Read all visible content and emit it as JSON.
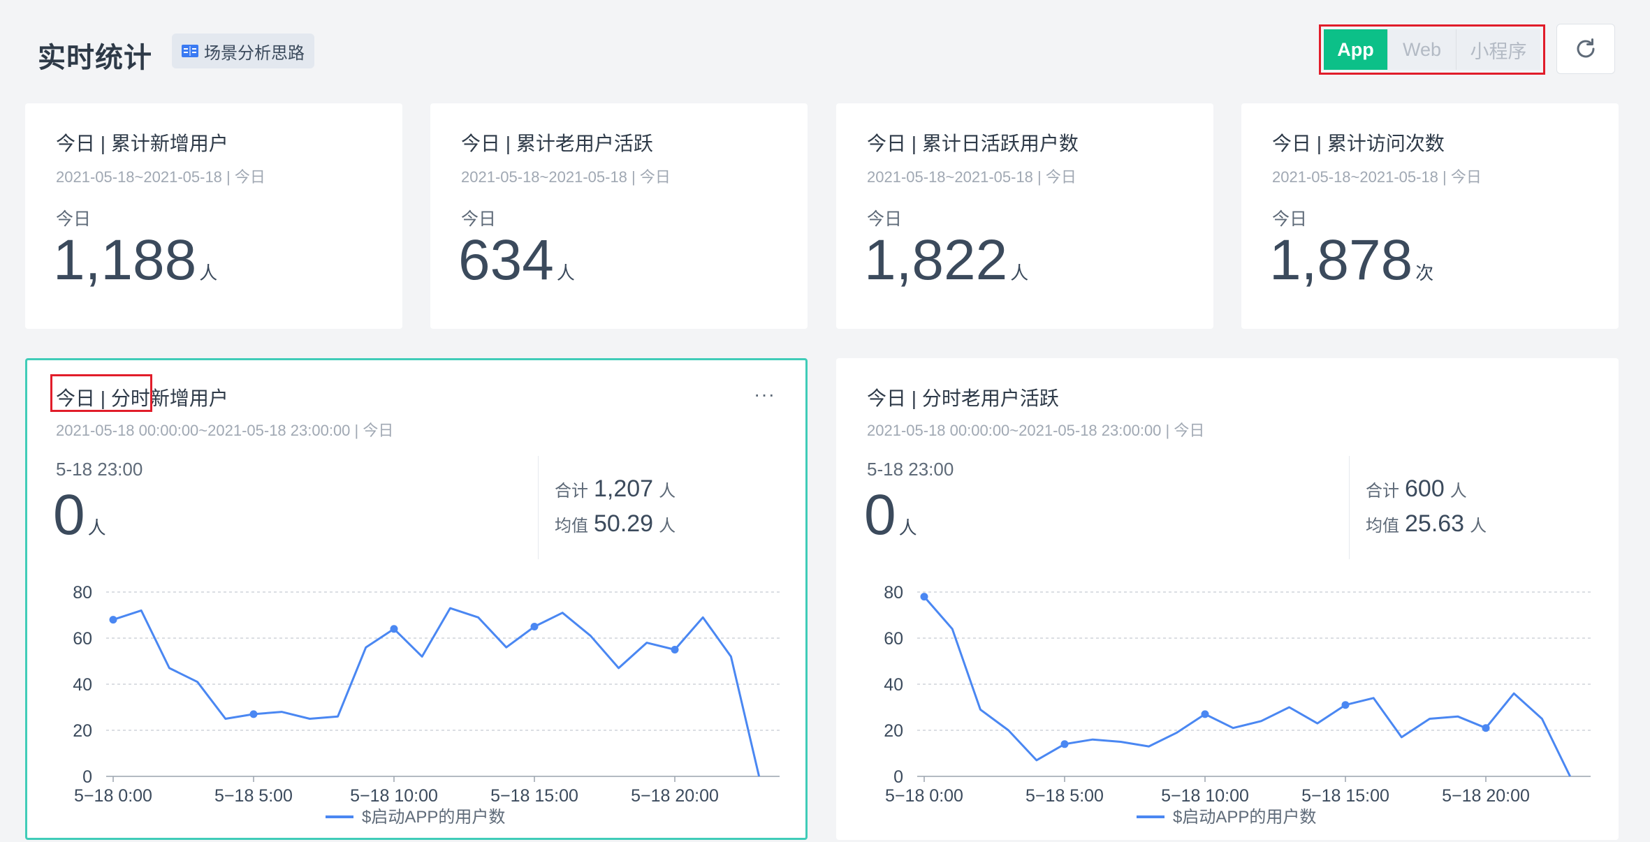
{
  "header": {
    "title": "实时统计",
    "scene_tag": "场景分析思路",
    "platforms": [
      "App",
      "Web",
      "小程序"
    ],
    "active_platform": "App"
  },
  "kpis": [
    {
      "title": "今日 | 累计新增用户",
      "date": "2021-05-18~2021-05-18 | 今日",
      "period": "今日",
      "value": "1,188",
      "unit": "人"
    },
    {
      "title": "今日 | 累计老用户活跃",
      "date": "2021-05-18~2021-05-18 | 今日",
      "period": "今日",
      "value": "634",
      "unit": "人"
    },
    {
      "title": "今日 | 累计日活跃用户数",
      "date": "2021-05-18~2021-05-18 | 今日",
      "period": "今日",
      "value": "1,822",
      "unit": "人"
    },
    {
      "title": "今日 | 累计访问次数",
      "date": "2021-05-18~2021-05-18 | 今日",
      "period": "今日",
      "value": "1,878",
      "unit": "次"
    }
  ],
  "charts": [
    {
      "title": "今日 | 分时新增用户",
      "date": "2021-05-18 00:00:00~2021-05-18 23:00:00 | 今日",
      "time": "5-18 23:00",
      "current": "0",
      "unit": "人",
      "sum_label": "合计",
      "sum": "1,207",
      "sum_unit": "人",
      "avg_label": "均值",
      "avg": "50.29",
      "avg_unit": "人",
      "more": "···"
    },
    {
      "title": "今日 | 分时老用户活跃",
      "date": "2021-05-18 00:00:00~2021-05-18 23:00:00 | 今日",
      "time": "5-18 23:00",
      "current": "0",
      "unit": "人",
      "sum_label": "合计",
      "sum": "600",
      "sum_unit": "人",
      "avg_label": "均值",
      "avg": "25.63",
      "avg_unit": "人"
    }
  ],
  "chart_data": [
    {
      "type": "line",
      "x": [
        "0:00",
        "1:00",
        "2:00",
        "3:00",
        "4:00",
        "5:00",
        "6:00",
        "7:00",
        "8:00",
        "9:00",
        "10:00",
        "11:00",
        "12:00",
        "13:00",
        "14:00",
        "15:00",
        "16:00",
        "17:00",
        "18:00",
        "19:00",
        "20:00",
        "21:00",
        "22:00",
        "23:00"
      ],
      "xticks": [
        "5−18 0:00",
        "5−18 5:00",
        "5−18 10:00",
        "5−18 15:00",
        "5−18 20:00"
      ],
      "yticks": [
        0,
        20,
        40,
        60,
        80
      ],
      "ylim": [
        0,
        80
      ],
      "series": [
        {
          "name": "$启动APP的用户数",
          "values": [
            68,
            72,
            47,
            41,
            25,
            27,
            28,
            25,
            26,
            56,
            64,
            52,
            73,
            69,
            56,
            65,
            71,
            61,
            47,
            58,
            55,
            69,
            52,
            0
          ]
        }
      ],
      "markers": [
        0,
        5,
        10,
        15,
        20
      ],
      "color": "#4a87f2",
      "grid": true,
      "legend": "bottom"
    },
    {
      "type": "line",
      "x": [
        "0:00",
        "1:00",
        "2:00",
        "3:00",
        "4:00",
        "5:00",
        "6:00",
        "7:00",
        "8:00",
        "9:00",
        "10:00",
        "11:00",
        "12:00",
        "13:00",
        "14:00",
        "15:00",
        "16:00",
        "17:00",
        "18:00",
        "19:00",
        "20:00",
        "21:00",
        "22:00",
        "23:00"
      ],
      "xticks": [
        "5−18 0:00",
        "5−18 5:00",
        "5−18 10:00",
        "5−18 15:00",
        "5−18 20:00"
      ],
      "yticks": [
        0,
        20,
        40,
        60,
        80
      ],
      "ylim": [
        0,
        80
      ],
      "series": [
        {
          "name": "$启动APP的用户数",
          "values": [
            78,
            64,
            29,
            20,
            7,
            14,
            16,
            15,
            13,
            19,
            27,
            21,
            24,
            30,
            23,
            31,
            34,
            17,
            25,
            26,
            21,
            36,
            25,
            0
          ]
        }
      ],
      "markers": [
        0,
        5,
        10,
        15,
        20
      ],
      "color": "#4a87f2",
      "grid": true,
      "legend": "bottom"
    }
  ]
}
